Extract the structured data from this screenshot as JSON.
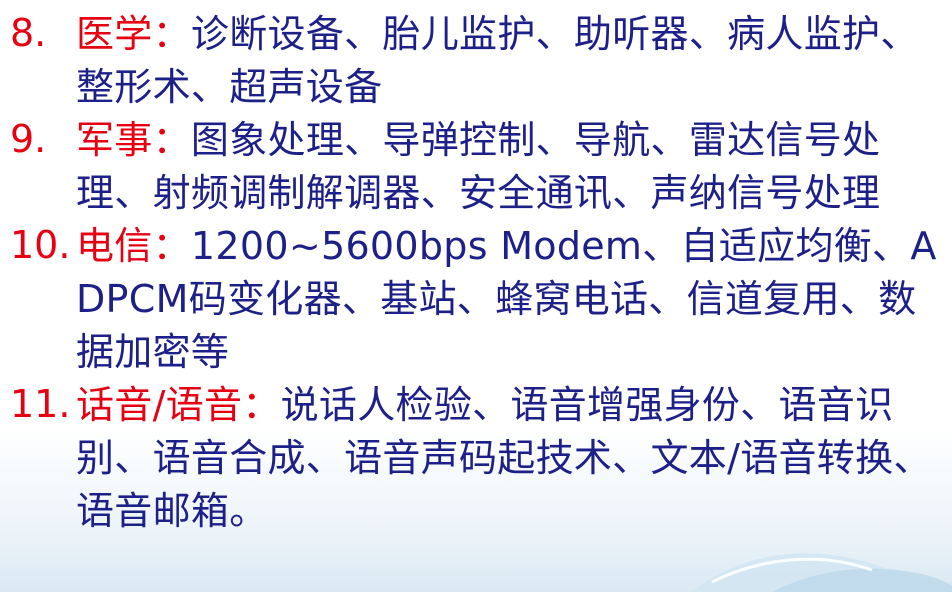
{
  "items": [
    {
      "number": "8.",
      "category": "医学",
      "separator": "：",
      "content": "诊断设备、胎儿监护、助听器、病人监护、整形术、超声设备"
    },
    {
      "number": "9.",
      "category": "军事",
      "separator": "：",
      "content": "图象处理、导弹控制、导航、雷达信号处理、射频调制解调器、安全通讯、声纳信号处理"
    },
    {
      "number": "10.",
      "category": "电信",
      "separator": "：",
      "content": "1200~5600bps  Modem、自适应均衡、ADPCM码变化器、基站、蜂窝电话、信道复用、数据加密等"
    },
    {
      "number": "11.",
      "category": "话音/语音",
      "separator": "：",
      "content": "说话人检验、语音增强身份、语音识别、语音合成、语音声码起技术、文本/语音转换、语音邮箱。"
    }
  ],
  "colors": {
    "number_and_category": "#e60012",
    "content": "#1d2088"
  }
}
